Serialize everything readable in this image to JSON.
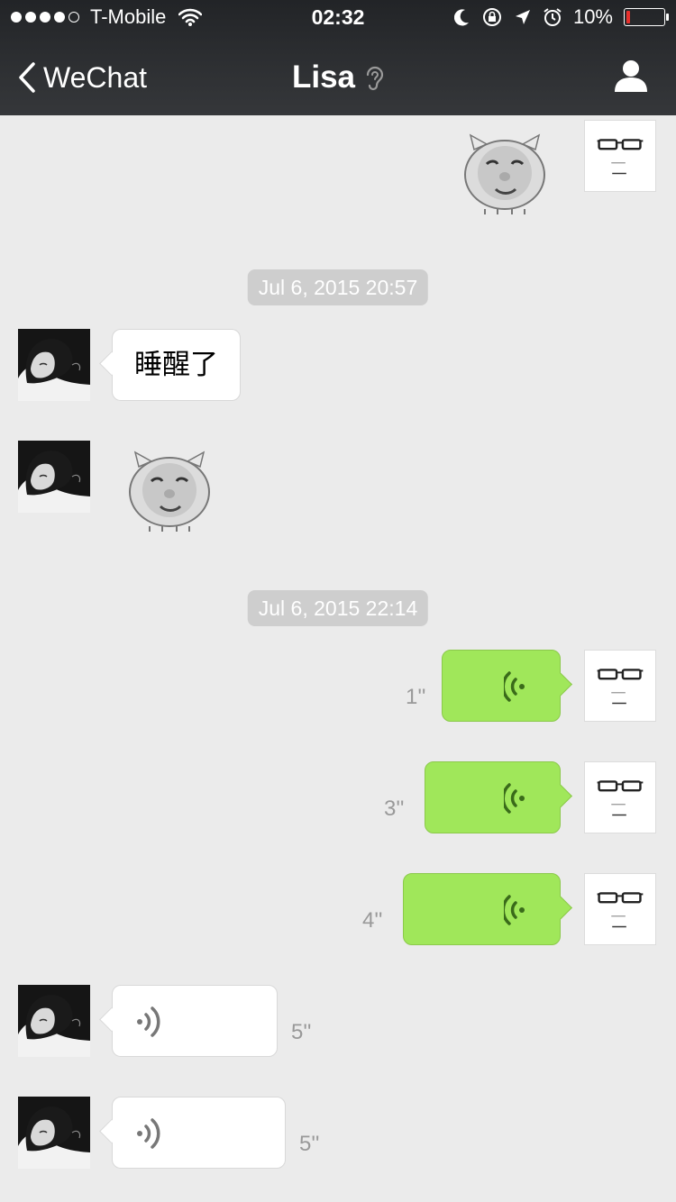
{
  "status_bar": {
    "carrier": "T-Mobile",
    "time": "02:32",
    "battery_percent": "10%",
    "battery_level": 0.1,
    "icons": [
      "signal-dots-icon",
      "wifi-icon",
      "moon-icon",
      "rotation-lock-icon",
      "location-arrow-icon",
      "alarm-icon",
      "battery-icon"
    ]
  },
  "nav": {
    "back_label": "WeChat",
    "title": "Lisa",
    "ear_icon": "earpiece-mode-icon",
    "profile_icon": "person-icon"
  },
  "messages": {
    "ts1": "Jul 6, 2015 20:57",
    "text1": "睡醒了",
    "ts2": "Jul 6, 2015 22:14",
    "voice1_duration": "1''",
    "voice2_duration": "3''",
    "voice3_duration": "4''",
    "voice4_duration": "5''",
    "voice5_duration": "5''"
  },
  "colors": {
    "header_bg": "#2e3033",
    "chat_bg": "#ebebeb",
    "outgoing_bubble": "#a0e75a",
    "incoming_bubble": "#ffffff",
    "timestamp_bg": "#cecece",
    "battery_low": "#e8302c"
  }
}
